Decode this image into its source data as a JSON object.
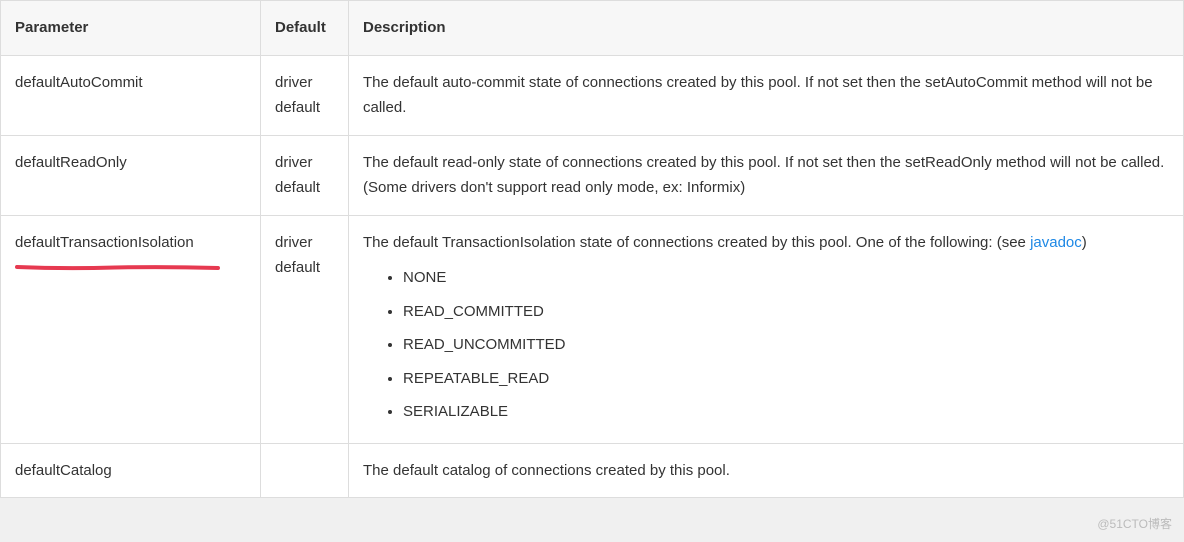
{
  "headers": {
    "parameter": "Parameter",
    "default": "Default",
    "description": "Description"
  },
  "rows": [
    {
      "parameter": "defaultAutoCommit",
      "default": "driver default",
      "description": "The default auto-commit state of connections created by this pool. If not set then the setAutoCommit method will not be called."
    },
    {
      "parameter": "defaultReadOnly",
      "default": "driver default",
      "description": "The default read-only state of connections created by this pool. If not set then the setReadOnly method will not be called. (Some drivers don't support read only mode, ex: Informix)"
    },
    {
      "parameter": "defaultTransactionIsolation",
      "default": "driver default",
      "description_prefix": "The default TransactionIsolation state of connections created by this pool. One of the following: (see ",
      "description_link": "javadoc",
      "description_suffix": ")",
      "list": [
        "NONE",
        "READ_COMMITTED",
        "READ_UNCOMMITTED",
        "REPEATABLE_READ",
        "SERIALIZABLE"
      ]
    },
    {
      "parameter": "defaultCatalog",
      "default": "",
      "description": "The default catalog of connections created by this pool."
    }
  ],
  "watermark": "@51CTO博客"
}
